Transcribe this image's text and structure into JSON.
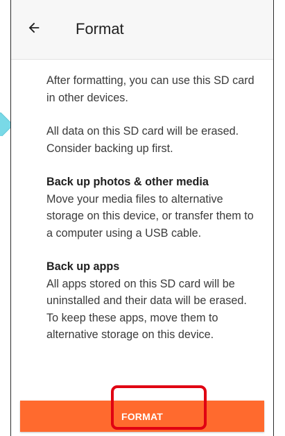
{
  "app_bar": {
    "title": "Format",
    "back_icon": "arrow-left-icon"
  },
  "content": {
    "intro": "After formatting, you can use this SD card in other devices.",
    "warning": "All data on this SD card will be erased. Consider backing up first.",
    "sections": [
      {
        "title": "Back up photos & other media",
        "body": "Move your media files to alternative storage on this device, or transfer them to a computer using a USB cable."
      },
      {
        "title": "Back up apps",
        "body": "All apps stored on this SD card will be uninstalled and their data will be erased. To keep these apps, move them to alternative storage on this device."
      }
    ]
  },
  "actions": {
    "format_label": "FORMAT"
  },
  "colors": {
    "button": "#ff6a2e",
    "highlight": "#e00012",
    "side_marker": "#79d9e7"
  }
}
